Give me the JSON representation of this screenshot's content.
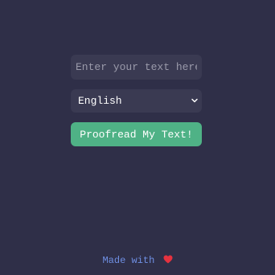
{
  "form": {
    "text_input": {
      "placeholder": "Enter your text here",
      "value": ""
    },
    "language_select": {
      "selected": "English"
    },
    "submit_label": "Proofread My Text!"
  },
  "footer": {
    "text": "Made with",
    "icon": "heart-icon"
  },
  "colors": {
    "background": "#2f2f48",
    "field": "#3a3a52",
    "accent": "#4fb286",
    "footer_text": "#6f8fe3",
    "heart": "#e5323f"
  }
}
